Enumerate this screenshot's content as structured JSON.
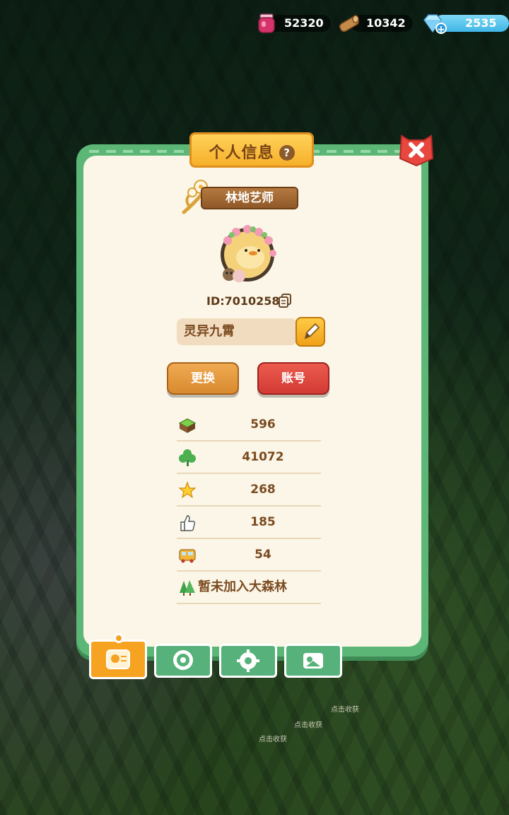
{
  "currencies": {
    "jam": {
      "value": "52320",
      "icon": "jam-jar-icon"
    },
    "wood": {
      "value": "10342",
      "icon": "wood-log-icon"
    },
    "gem": {
      "value": "2535",
      "icon": "diamond-icon",
      "plus": "+"
    }
  },
  "panel": {
    "title": "个人信息",
    "help": "?",
    "player_title": "林地艺师",
    "player_id": "ID:7010258",
    "player_name": "灵异九霄",
    "change_label": "更换",
    "account_label": "账号"
  },
  "stats": [
    {
      "icon": "grass-block-icon",
      "value": "596"
    },
    {
      "icon": "clover-icon",
      "value": "41072"
    },
    {
      "icon": "star-icon",
      "value": "268"
    },
    {
      "icon": "thumbs-up-icon",
      "value": "185"
    },
    {
      "icon": "bus-icon",
      "value": "54"
    }
  ],
  "forest_status": "暂未加入大森林",
  "tabs": [
    {
      "name": "profile",
      "active": true
    },
    {
      "name": "badges",
      "active": false
    },
    {
      "name": "settings",
      "active": false
    },
    {
      "name": "album",
      "active": false
    }
  ],
  "scene_labels": [
    "点击收获",
    "点击收获",
    "点击收获"
  ],
  "colors": {
    "panel_green": "#5cb776",
    "panel_cream": "#fbf6e7",
    "title_orange": "#f6b02a",
    "close_red": "#e8473f",
    "text_brown": "#7b4b21"
  }
}
